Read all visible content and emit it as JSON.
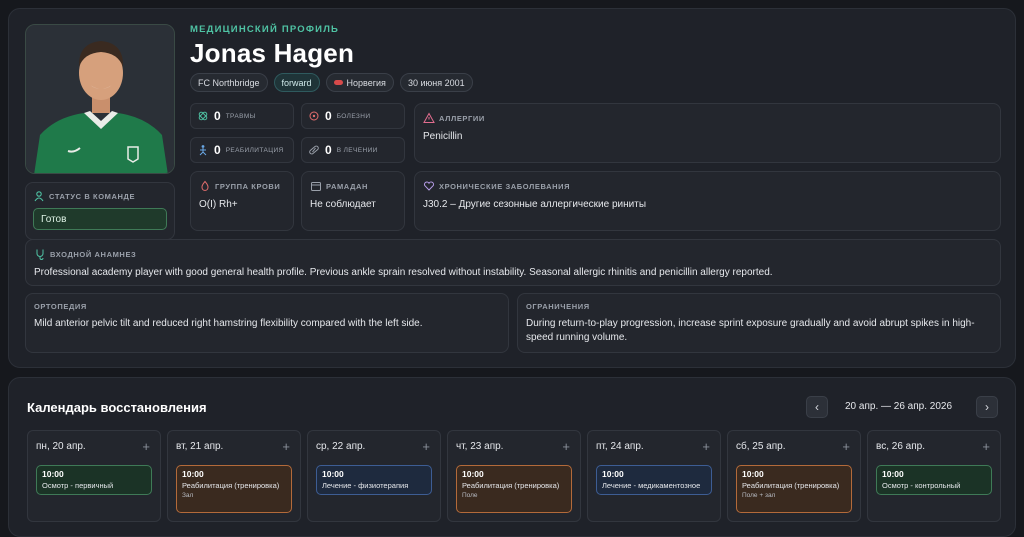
{
  "profile": {
    "eyebrow": "МЕДИЦИНСКИЙ ПРОФИЛЬ",
    "name": "Jonas Hagen",
    "club": "FC Northbridge",
    "position": "forward",
    "country": "Норвегия",
    "dob": "30 июня 2001",
    "team_status_label": "СТАТУС В КОМАНДЕ",
    "team_status_value": "Готов"
  },
  "stats": {
    "injuries": {
      "value": "0",
      "label": "ТРАВМЫ"
    },
    "illnesses": {
      "value": "0",
      "label": "БОЛЕЗНИ"
    },
    "rehab": {
      "value": "0",
      "label": "РЕАБИЛИТАЦИЯ"
    },
    "treatment": {
      "value": "0",
      "label": "В ЛЕЧЕНИИ"
    }
  },
  "cards": {
    "allergies_label": "АЛЛЕРГИИ",
    "allergies_value": "Penicillin",
    "blood_label": "ГРУППА КРОВИ",
    "blood_value": "O(I) Rh+",
    "ramadan_label": "РАМАДАН",
    "ramadan_value": "Не соблюдает",
    "chronic_label": "ХРОНИЧЕСКИЕ ЗАБОЛЕВАНИЯ",
    "chronic_value": "J30.2 – Другие сезонные аллергические риниты",
    "anamnesis_label": "ВХОДНОЙ АНАМНЕЗ",
    "anamnesis_value": "Professional academy player with good general health profile. Previous ankle sprain resolved without instability. Seasonal allergic rhinitis and penicillin allergy reported.",
    "ortho_label": "ОРТОПЕДИЯ",
    "ortho_value": "Mild anterior pelvic tilt and reduced right hamstring flexibility compared with the left side.",
    "limits_label": "ОГРАНИЧЕНИЯ",
    "limits_value": "During return-to-play progression, increase sprint exposure gradually and avoid abrupt spikes in high-speed running volume."
  },
  "calendar": {
    "title": "Календарь восстановления",
    "range": "20 апр. — 26 апр. 2026",
    "prev_icon": "chevron-left-icon",
    "next_icon": "chevron-right-icon",
    "days": [
      {
        "label": "пн, 20 апр.",
        "event": {
          "time": "10:00",
          "title": "Осмотр - первичный",
          "sub": "",
          "kind": "green"
        }
      },
      {
        "label": "вт, 21 апр.",
        "event": {
          "time": "10:00",
          "title": "Реабилитация (тренировка)",
          "sub": "Зал",
          "kind": "orange"
        }
      },
      {
        "label": "ср, 22 апр.",
        "event": {
          "time": "10:00",
          "title": "Лечение - физиотерапия",
          "sub": "",
          "kind": "blue"
        }
      },
      {
        "label": "чт, 23 апр.",
        "event": {
          "time": "10:00",
          "title": "Реабилитация (тренировка)",
          "sub": "Поле",
          "kind": "orange"
        }
      },
      {
        "label": "пт, 24 апр.",
        "event": {
          "time": "10:00",
          "title": "Лечение - медикаментозное",
          "sub": "",
          "kind": "blue"
        }
      },
      {
        "label": "сб, 25 апр.",
        "event": {
          "time": "10:00",
          "title": "Реабилитация (тренировка)",
          "sub": "Поле + зал",
          "kind": "orange"
        }
      },
      {
        "label": "вс, 26 апр.",
        "event": {
          "time": "10:00",
          "title": "Осмотр - контрольный",
          "sub": "",
          "kind": "green"
        }
      }
    ]
  },
  "colors": {
    "accent": "#4fc3a4",
    "green_event": "#3f7a57",
    "orange_event": "#b36a3a",
    "blue_event": "#3d5d94"
  }
}
